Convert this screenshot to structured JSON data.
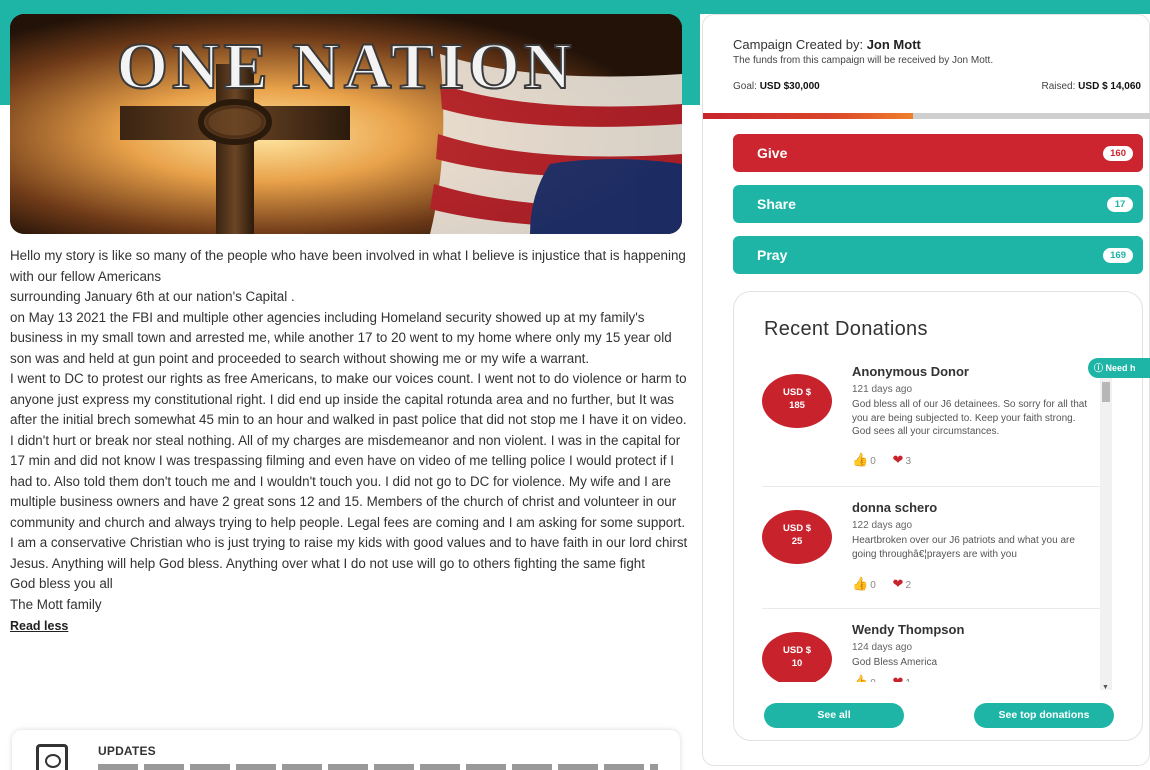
{
  "hero": {
    "title": "ONE NATION"
  },
  "story": {
    "paragraphs": [
      "Hello my story is like so many of the people who have been involved in what I believe is injustice that is happening with our fellow Americans",
      "surrounding January 6th at our nation's Capital .",
      "on May 13 2021 the FBI and multiple other agencies including Homeland security showed up at my family's business in my small town and arrested me, while another 17 to 20 went to my home where only my 15 year old son was and held at gun point and proceeded to search without showing me or my wife a warrant.",
      "I went to DC to protest our rights as free Americans, to make our voices count. I went not to do violence or harm to anyone just express my constitutional right. I did end up inside the capital rotunda area and no further, but It was after the initial brech somewhat 45 min to an hour and walked in past police that did not stop me I have it on video. I didn't hurt or break nor steal nothing. All of my charges are misdemeanor and non violent.  I was in the capital for 17 min and did not know I was trespassing filming and even have on video of me telling police I would protect if I had to. Also told them don't touch me and I wouldn't touch you. I did not go to DC for violence. My wife and I are multiple business owners and have 2 great sons 12 and 15. Members of the church of christ and volunteer in our community and church and always trying to help people. Legal fees are coming and I am asking for some support. I am a conservative Christian who is just trying to raise my kids with good values and to have faith in our lord chirst Jesus. Anything will help God bless. Anything over what I do not use will go to others fighting the same fight",
      "God bless you all",
      "The Mott family"
    ],
    "read_less": "Read less"
  },
  "updates": {
    "label": "UPDATES"
  },
  "campaign": {
    "created_by_label": "Campaign Created by:",
    "creator": "Jon Mott",
    "funds_note": "The funds from this campaign will be received by Jon Mott.",
    "goal_label": "Goal:",
    "goal_value": "USD $30,000",
    "raised_label": "Raised:",
    "raised_value": "USD $ 14,060",
    "progress_fraction": 0.4687
  },
  "actions": {
    "give": {
      "label": "Give",
      "count": "160"
    },
    "share": {
      "label": "Share",
      "count": "17"
    },
    "pray": {
      "label": "Pray",
      "count": "169"
    }
  },
  "recent": {
    "title": "Recent Donations",
    "donations": [
      {
        "currency": "USD $",
        "amount": "185",
        "name": "Anonymous Donor",
        "time": "121 days ago",
        "message": "God bless all of our J6 detainees. So sorry for all that you are being subjected to. Keep your faith strong. God sees all your circumstances.",
        "likes": "0",
        "hearts": "3"
      },
      {
        "currency": "USD $",
        "amount": "25",
        "name": "donna schero",
        "time": "122 days ago",
        "message": "Heartbroken over our J6 patriots and what you are going throughâ€¦prayers are with you",
        "likes": "0",
        "hearts": "2"
      },
      {
        "currency": "USD $",
        "amount": "10",
        "name": "Wendy Thompson",
        "time": "124 days ago",
        "message": "God Bless America",
        "likes": "0",
        "hearts": "1"
      }
    ],
    "see_all": "See all",
    "see_top": "See top donations"
  },
  "help": {
    "label": "Need h"
  },
  "colors": {
    "teal": "#1fb5a6",
    "red": "#cc2530"
  }
}
